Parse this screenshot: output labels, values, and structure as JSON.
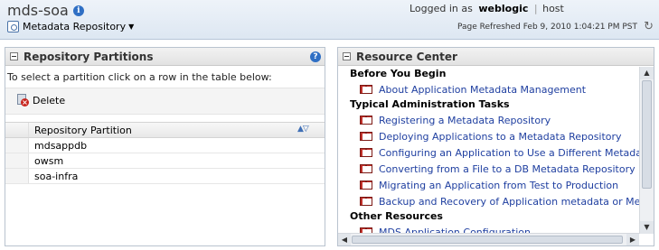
{
  "header": {
    "title": "mds-soa",
    "target_menu_label": "Metadata Repository",
    "logged_in_prefix": "Logged in as",
    "user": "weblogic",
    "host": "host",
    "page_refreshed": "Page Refreshed Feb 9, 2010 1:04:21 PM PST"
  },
  "repository_partitions": {
    "title": "Repository Partitions",
    "instruction": "To select a partition click on a row in the table below:",
    "delete_label": "Delete",
    "column_header": "Repository Partition",
    "rows": [
      "mdsappdb",
      "owsm",
      "soa-infra"
    ]
  },
  "resource_center": {
    "title": "Resource Center",
    "sections": [
      {
        "heading": "Before You Begin",
        "items": [
          "About Application Metadata Management"
        ]
      },
      {
        "heading": "Typical Administration Tasks",
        "items": [
          "Registering a Metadata Repository",
          "Deploying Applications to a Metadata Repository",
          "Configuring an Application to Use a Different Metadata Repo",
          "Converting from a File to a DB Metadata Repository",
          "Migrating an Application from Test to Production",
          "Backup and Recovery of Application metadata or Metadata R"
        ]
      },
      {
        "heading": "Other Resources",
        "items": [
          "MDS Application Configuration"
        ]
      }
    ]
  },
  "icons": {
    "info": "info-icon",
    "help": "help-icon",
    "refresh": "refresh-icon",
    "book": "book-icon",
    "delete": "delete-icon"
  },
  "colors": {
    "link": "#1f3fa0",
    "header_bg": "#dde7f2",
    "accent_blue": "#2f6fc4"
  }
}
